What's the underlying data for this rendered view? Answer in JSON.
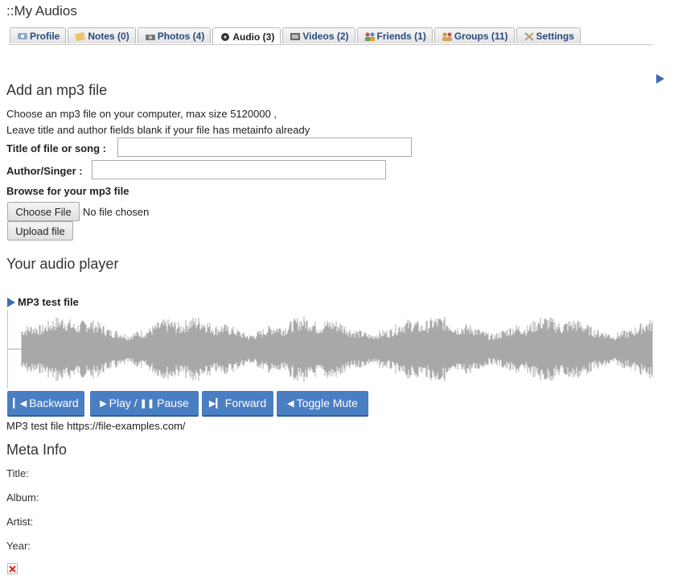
{
  "page": {
    "title": "::My Audios"
  },
  "tabs": [
    {
      "label": "Profile",
      "icon": "profile-icon"
    },
    {
      "label": "Notes (0)",
      "icon": "notes-icon"
    },
    {
      "label": "Photos (4)",
      "icon": "camera-icon"
    },
    {
      "label": "Audio (3)",
      "icon": "audio-icon"
    },
    {
      "label": "Videos (2)",
      "icon": "video-icon"
    },
    {
      "label": "Friends (1)",
      "icon": "friends-icon"
    },
    {
      "label": "Groups (11)",
      "icon": "groups-icon"
    },
    {
      "label": "Settings",
      "icon": "tools-icon"
    }
  ],
  "active_tab": "Audio (3)",
  "add": {
    "heading": "Add an mp3 file",
    "desc1": "Choose an mp3 file on your computer, max size 5120000 ,",
    "desc2": "Leave title and author fields blank if your file has metainfo already",
    "title_label": "Title of file or song :",
    "title_value": "",
    "author_label": "Author/Singer :",
    "author_value": "",
    "browse_label": "Browse for your mp3 file",
    "choose_button": "Choose File",
    "no_file": "No file chosen",
    "upload_button": "Upload file"
  },
  "player": {
    "heading": "Your audio player",
    "track_name": "MP3 test file",
    "buttons": {
      "backward": "Backward",
      "play_pause": "Play / ",
      "pause": "Pause",
      "forward": "Forward",
      "mute": "Toggle Mute"
    },
    "caption": "MP3 test file https://file-examples.com/"
  },
  "meta": {
    "heading": "Meta Info",
    "title_label": "Title:",
    "album_label": "Album:",
    "artist_label": "Artist:",
    "year_label": "Year:"
  },
  "colors": {
    "accent": "#4a7ec2",
    "waveform": "#a8a8a8",
    "tab_text": "#2a4b7c"
  }
}
